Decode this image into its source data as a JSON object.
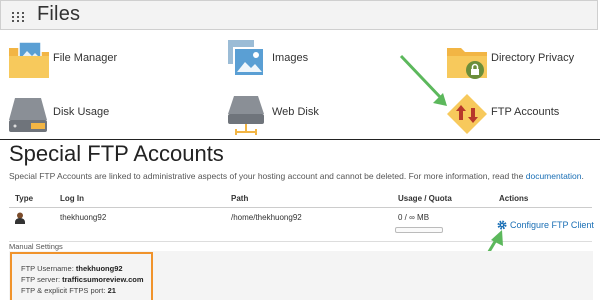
{
  "files_section": {
    "title": "Files",
    "tiles": [
      {
        "label": "File Manager",
        "icon": "folder-image-icon"
      },
      {
        "label": "Images",
        "icon": "images-icon"
      },
      {
        "label": "Directory Privacy",
        "icon": "folder-lock-icon"
      },
      {
        "label": "Disk Usage",
        "icon": "disk-usage-icon"
      },
      {
        "label": "Web Disk",
        "icon": "web-disk-icon"
      },
      {
        "label": "FTP Accounts",
        "icon": "ftp-arrows-icon"
      }
    ]
  },
  "ftp": {
    "title": "Special FTP Accounts",
    "description": "Special FTP Accounts are linked to administrative aspects of your hosting account and cannot be deleted. For more information, read the",
    "doc_link": "documentation",
    "headers": {
      "type": "Type",
      "login": "Log In",
      "path": "Path",
      "usage": "Usage / Quota",
      "actions": "Actions"
    },
    "row": {
      "login": "thekhuong92",
      "path": "/home/thekhuong92",
      "usage": "0 / ∞ MB",
      "action": "Configure FTP Client"
    },
    "manual": {
      "label": "Manual Settings",
      "username_label": "FTP Username:",
      "username": "thekhuong92",
      "server_label": "FTP server:",
      "server": "trafficsumoreview.com",
      "port_label": "FTP & explicit FTPS port:",
      "port": "21"
    }
  },
  "colors": {
    "accent_link": "#1a6fb5",
    "highlight_box": "#f0932b",
    "annotation_arrow": "#5cb85c",
    "folder": "#f2b544"
  }
}
